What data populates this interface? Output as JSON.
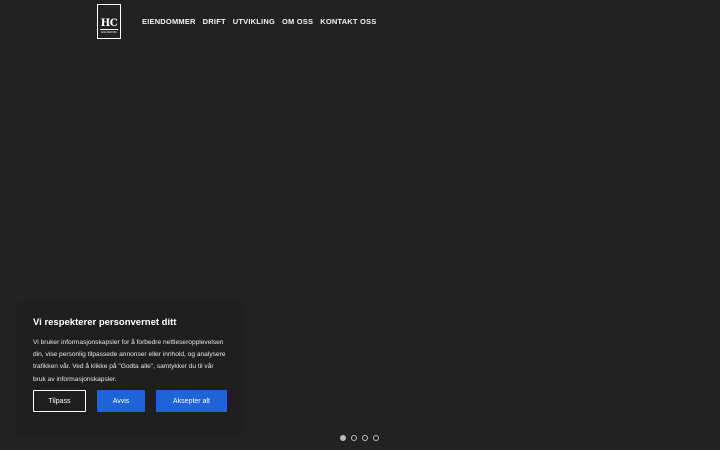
{
  "logo": {
    "mark": "HC",
    "sub": "EIENDOM"
  },
  "nav": {
    "items": [
      "EIENDOMMER",
      "DRIFT",
      "UTVIKLING",
      "OM OSS",
      "KONTAKT OSS"
    ]
  },
  "cookie_banner": {
    "title": "Vi respekterer personvernet ditt",
    "text": "Vi bruker informasjonskapsler for å forbedre nettleseropplevelsen din, vise personlig tilpassede annonser eller innhold, og analysere trafikken vår. Ved å klikke på \"Godta alle\", samtykker du til vår bruk av informasjonskapsler.",
    "customize_label": "Tilpass",
    "reject_label": "Avvis",
    "accept_label": "Aksepter alt"
  },
  "slider": {
    "slide_count": 4,
    "active_index": 0
  },
  "colors": {
    "background": "#222222",
    "accent": "#1e63d8"
  }
}
